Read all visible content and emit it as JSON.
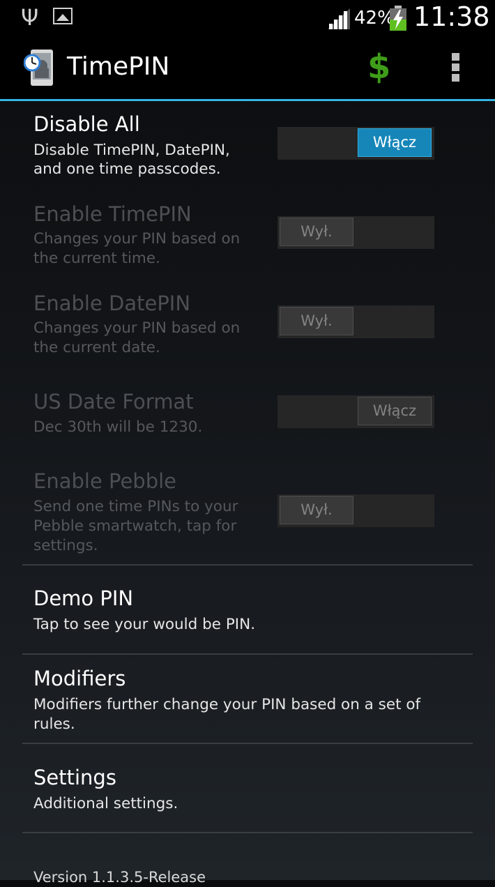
{
  "status_bar": {
    "usb_icon": "usb-icon",
    "image_icon": "image-icon",
    "battery_percent": "42%",
    "time": "11:38"
  },
  "action_bar": {
    "title": "TimePIN",
    "donate_icon_glyph": "$",
    "accent_color": "#33b5e5"
  },
  "preferences": {
    "disable_all": {
      "title": "Disable All",
      "summary_line1": "Disable TimePIN, DatePIN,",
      "summary_line2": "and one time passcodes.",
      "switch_label": "Włącz",
      "checked": true
    },
    "enable_timepin": {
      "title": "Enable TimePIN",
      "summary_line1": "Changes your PIN based on",
      "summary_line2": "the current time.",
      "switch_label": "Wył.",
      "checked": false
    },
    "enable_datepin": {
      "title": "Enable DatePIN",
      "summary_line1": "Changes your PIN based on",
      "summary_line2": "the current date.",
      "switch_label": "Wył.",
      "checked": false
    },
    "us_date_format": {
      "title": "US Date Format",
      "summary_line1": "Dec 30th will be 1230.",
      "switch_label": "Włącz",
      "checked": true
    },
    "enable_pebble": {
      "title": "Enable Pebble",
      "summary_line1": "Send one time PINs to your",
      "summary_line2": "Pebble smartwatch, tap for",
      "summary_line3": "settings.",
      "switch_label": "Wył.",
      "checked": false
    },
    "demo_pin": {
      "title": "Demo PIN",
      "summary_line1": "Tap to see your would be PIN."
    },
    "modifiers": {
      "title": "Modifiers",
      "summary_line1": "Modifiers further change your PIN based on a set of",
      "summary_line2": "rules."
    },
    "settings": {
      "title": "Settings",
      "summary_line1": "Additional settings."
    }
  },
  "footer": {
    "version": "Version 1.1.3.5-Release"
  }
}
